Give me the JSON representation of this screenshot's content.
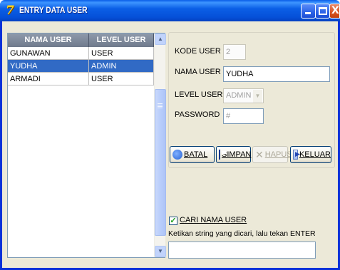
{
  "window": {
    "title": "ENTRY DATA USER",
    "icon": "app-icon",
    "minimize_label": "",
    "maximize_label": "",
    "close_label": "X"
  },
  "grid": {
    "columns": [
      "NAMA USER",
      "LEVEL USER"
    ],
    "rows": [
      {
        "nama": "GUNAWAN",
        "level": "USER",
        "selected": false
      },
      {
        "nama": "YUDHA",
        "level": "ADMIN",
        "selected": true
      },
      {
        "nama": "ARMADI",
        "level": "USER",
        "selected": false
      }
    ]
  },
  "form": {
    "kode_user_label": "KODE USER",
    "kode_user_value": "2",
    "nama_user_label": "NAMA USER",
    "nama_user_value": "YUDHA",
    "level_user_label": "LEVEL USER",
    "level_user_value": "ADMIN",
    "password_label": "PASSWORD",
    "password_value": "#"
  },
  "buttons": {
    "batal": "BATAL",
    "simpan": "SIMPAN",
    "hapus": "HAPUS",
    "keluar": "KELUAR"
  },
  "search": {
    "checkbox_label": "CARI NAMA USER",
    "checked": true,
    "hint": "Ketikan string yang dicari, lalu tekan ENTER",
    "value": ""
  },
  "colors": {
    "titlebar": "#0550d8",
    "selection": "#316ac5",
    "header": "#7f8a9c"
  }
}
